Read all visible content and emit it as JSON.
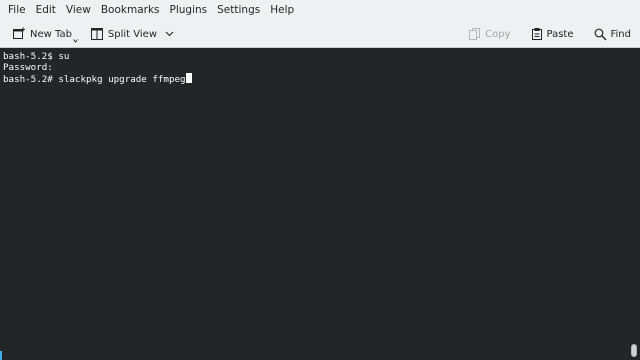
{
  "menubar": {
    "items": [
      "File",
      "Edit",
      "View",
      "Bookmarks",
      "Plugins",
      "Settings",
      "Help"
    ]
  },
  "toolbar": {
    "new_tab_label": "New Tab",
    "split_view_label": "Split View",
    "copy_label": "Copy",
    "paste_label": "Paste",
    "find_label": "Find"
  },
  "terminal": {
    "lines": [
      "bash-5.2$ su",
      "Password:",
      "bash-5.2# slackpkg upgrade ffmpeg"
    ]
  },
  "colors": {
    "toolbar_bg": "#eff0f1",
    "terminal_bg": "#232627",
    "terminal_fg": "#fcfcfc",
    "accent": "#3daee9"
  }
}
